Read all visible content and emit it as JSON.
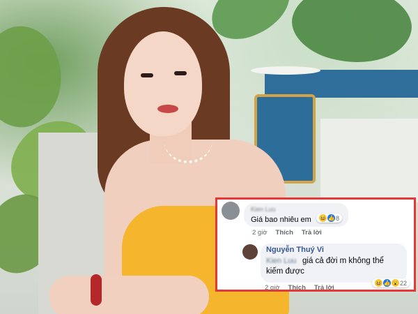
{
  "comments": [
    {
      "author": "Kien Luu",
      "text": "Giá bao nhiêu em",
      "reactions": {
        "icons": [
          "haha",
          "like"
        ],
        "count": "8"
      },
      "time": "2 giờ",
      "like_label": "Thích",
      "reply_label": "Trả lời",
      "replies": [
        {
          "author": "Nguyễn Thuý Vi",
          "mention": "Kien Luu",
          "text": "giá cả đời m không thể kiếm được",
          "reactions": {
            "icons": [
              "haha",
              "like",
              "wow"
            ],
            "count": "22"
          },
          "time": "2 giờ",
          "like_label": "Thích",
          "reply_label": "Trả lời"
        }
      ]
    }
  ],
  "colors": {
    "highlight_border": "#e53935",
    "bubble": "#f0f2f5",
    "reply_author": "#385898",
    "dress": "#f5b52c"
  },
  "emoji": {
    "haha": "😆",
    "like": "👍",
    "wow": "😮"
  }
}
